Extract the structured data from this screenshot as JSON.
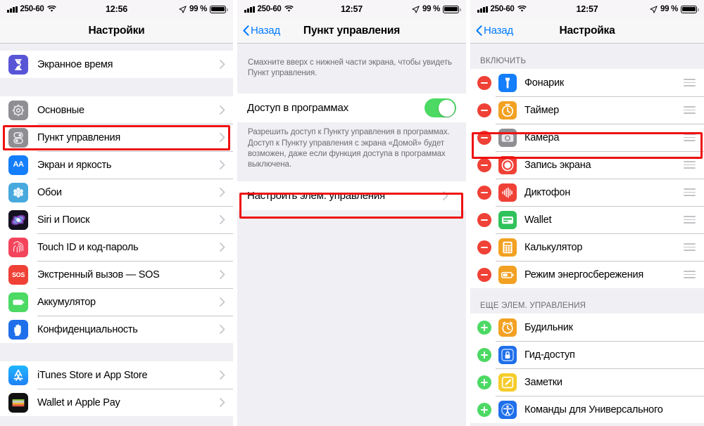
{
  "meta": {
    "accent_blue": "#007aff",
    "annotation_red": "#ee1111",
    "toggle_green": "#4cd964",
    "badge_red": "#ef4136",
    "list_bg": "#efeff4"
  },
  "panels": [
    {
      "id": "settings",
      "status": {
        "carrier": "250-60",
        "time": "12:56",
        "battery_pct": "99 %"
      },
      "nav": {
        "title": "Настройки",
        "back_label": ""
      },
      "sections": [
        {
          "rows": [
            {
              "label": "Экранное время",
              "icon": "screen-time-icon",
              "chevron": true
            }
          ]
        },
        {
          "rows": [
            {
              "label": "Основные",
              "icon": "general-gear-icon",
              "chevron": true
            },
            {
              "label": "Пункт управления",
              "icon": "control-center-icon",
              "chevron": true,
              "highlight": true
            },
            {
              "label": "Экран и яркость",
              "icon": "display-brightness-icon",
              "chevron": true
            },
            {
              "label": "Обои",
              "icon": "wallpaper-icon",
              "chevron": true
            },
            {
              "label": "Siri и Поиск",
              "icon": "siri-icon",
              "chevron": true
            },
            {
              "label": "Touch ID и код-пароль",
              "icon": "touch-id-icon",
              "chevron": true
            },
            {
              "label": "Экстренный вызов — SOS",
              "icon": "sos-icon",
              "chevron": true
            },
            {
              "label": "Аккумулятор",
              "icon": "battery-icon",
              "chevron": true
            },
            {
              "label": "Конфиденциальность",
              "icon": "privacy-hand-icon",
              "chevron": true
            }
          ]
        },
        {
          "rows": [
            {
              "label": "iTunes Store и App Store",
              "icon": "app-store-icon",
              "chevron": true
            },
            {
              "label": "Wallet и Apple Pay",
              "icon": "wallet-icon",
              "chevron": true
            }
          ]
        }
      ]
    },
    {
      "id": "control-center",
      "status": {
        "carrier": "250-60",
        "time": "12:57",
        "battery_pct": "99 %"
      },
      "nav": {
        "title": "Пункт управления",
        "back_label": "Назад"
      },
      "footnote_top": "Смахните вверх с нижней части экрана, чтобы увидеть Пункт управления.",
      "toggle_row": {
        "label": "Доступ в программах",
        "state": "on"
      },
      "footnote_bottom": "Разрешить доступ к Пункту управления в программах. Доступ к Пункту управления с экрана «Домой» будет возможен, даже если функция доступа в программах выключена.",
      "customize_row": {
        "label": "Настроить элем. управления",
        "chevron": true,
        "highlight": true
      }
    },
    {
      "id": "customize",
      "status": {
        "carrier": "250-60",
        "time": "12:57",
        "battery_pct": "99 %"
      },
      "nav": {
        "title": "Настройка",
        "back_label": "Назад"
      },
      "sections": [
        {
          "header": "ВКЛЮЧИТЬ",
          "action": "minus",
          "rows": [
            {
              "label": "Фонарик",
              "icon": "flashlight-icon"
            },
            {
              "label": "Таймер",
              "icon": "timer-icon"
            },
            {
              "label": "Камера",
              "icon": "camera-icon"
            },
            {
              "label": "Запись экрана",
              "icon": "screen-record-icon",
              "highlight": true
            },
            {
              "label": "Диктофон",
              "icon": "voice-memos-icon"
            },
            {
              "label": "Wallet",
              "icon": "wallet-icon"
            },
            {
              "label": "Калькулятор",
              "icon": "calculator-icon"
            },
            {
              "label": "Режим энергосбережения",
              "icon": "low-power-icon"
            }
          ]
        },
        {
          "header": "ЕЩЕ ЭЛЕМ. УПРАВЛЕНИЯ",
          "action": "plus",
          "rows": [
            {
              "label": "Будильник",
              "icon": "alarm-icon"
            },
            {
              "label": "Гид-доступ",
              "icon": "guided-access-icon"
            },
            {
              "label": "Заметки",
              "icon": "notes-icon"
            },
            {
              "label": "Команды для Универсального",
              "icon": "accessibility-shortcut-icon"
            }
          ]
        }
      ]
    }
  ]
}
